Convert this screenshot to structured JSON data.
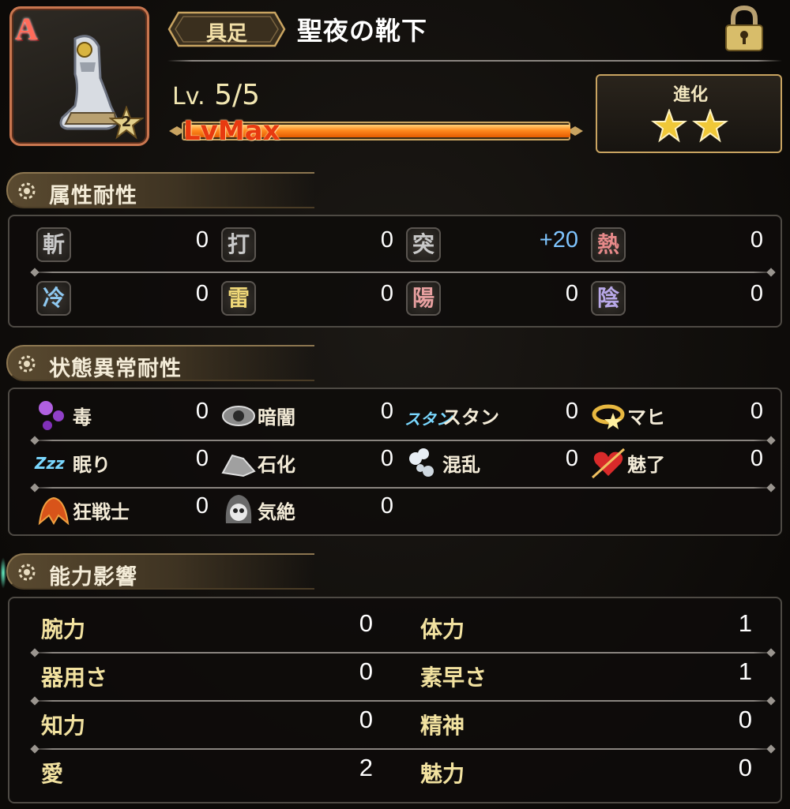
{
  "header": {
    "card_rank": "A",
    "card_stars": "2",
    "category": "具足",
    "item_name": "聖夜の靴下",
    "level_prefix": "Lv.",
    "level_value": "5/5",
    "level_bar_label": "LvMax",
    "level_progress": 1.0,
    "evolution_label": "進化",
    "evolution_stars": 2
  },
  "sections": {
    "element_resist": "属性耐性",
    "status_resist": "状態異常耐性",
    "ability_effect": "能力影響"
  },
  "element_resist": [
    {
      "label": "斬",
      "value": "0",
      "color": "#c9c9c9"
    },
    {
      "label": "打",
      "value": "0",
      "color": "#c9c9c9"
    },
    {
      "label": "突",
      "value": "+20",
      "color": "#c9c9c9"
    },
    {
      "label": "熱",
      "value": "0",
      "color": "#e88a8a"
    },
    {
      "label": "冷",
      "value": "0",
      "color": "#8ec8f0"
    },
    {
      "label": "雷",
      "value": "0",
      "color": "#f0d878"
    },
    {
      "label": "陽",
      "value": "0",
      "color": "#e8a0a0"
    },
    {
      "label": "陰",
      "value": "0",
      "color": "#b8a8e8"
    }
  ],
  "status_resist": [
    {
      "label": "毒",
      "value": "0",
      "icon": "poison-icon"
    },
    {
      "label": "暗闇",
      "value": "0",
      "icon": "eye-icon"
    },
    {
      "label": "スタン",
      "value": "0",
      "icon": "stun-icon",
      "icon_text": "スタン"
    },
    {
      "label": "マヒ",
      "value": "0",
      "icon": "paralysis-icon"
    },
    {
      "label": "眠り",
      "value": "0",
      "icon": "sleep-icon",
      "icon_text": "Zzz"
    },
    {
      "label": "石化",
      "value": "0",
      "icon": "stone-icon"
    },
    {
      "label": "混乱",
      "value": "0",
      "icon": "confusion-icon"
    },
    {
      "label": "魅了",
      "value": "0",
      "icon": "heart-arrow-icon"
    },
    {
      "label": "狂戦士",
      "value": "0",
      "icon": "berserk-icon"
    },
    {
      "label": "気絶",
      "value": "0",
      "icon": "skull-icon"
    }
  ],
  "ability_effect": [
    {
      "label": "腕力",
      "value": "0"
    },
    {
      "label": "体力",
      "value": "1"
    },
    {
      "label": "器用さ",
      "value": "0"
    },
    {
      "label": "素早さ",
      "value": "1"
    },
    {
      "label": "知力",
      "value": "0"
    },
    {
      "label": "精神",
      "value": "0"
    },
    {
      "label": "愛",
      "value": "2"
    },
    {
      "label": "魅力",
      "value": "0"
    }
  ]
}
